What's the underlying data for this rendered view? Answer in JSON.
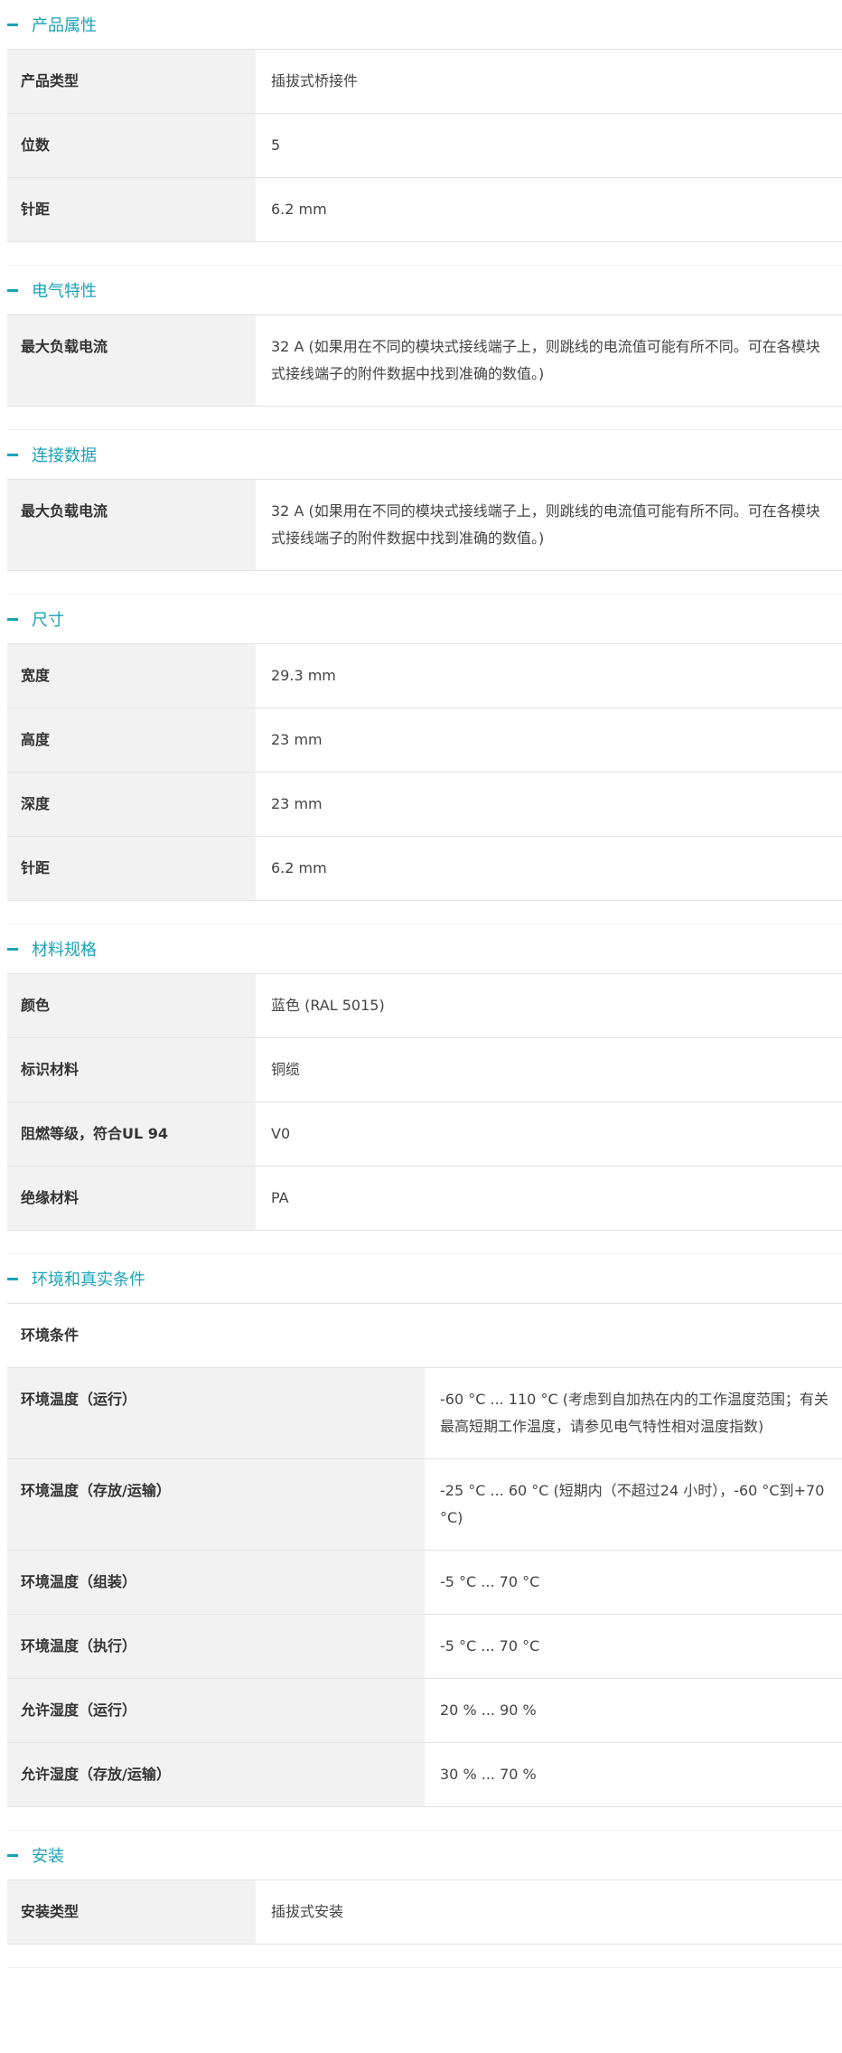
{
  "accent_color": "#1aa3b7",
  "sections": [
    {
      "title": "产品属性",
      "rows": [
        {
          "label": "产品类型",
          "value": "插拔式桥接件"
        },
        {
          "label": "位数",
          "value": "5"
        },
        {
          "label": "针距",
          "value": "6.2 mm"
        }
      ]
    },
    {
      "title": "电气特性",
      "rows": [
        {
          "label": "最大负载电流",
          "value": "32 A (如果用在不同的模块式接线端子上，则跳线的电流值可能有所不同。可在各模块式接线端子的附件数据中找到准确的数值。)"
        }
      ]
    },
    {
      "title": "连接数据",
      "rows": [
        {
          "label": "最大负载电流",
          "value": "32 A (如果用在不同的模块式接线端子上，则跳线的电流值可能有所不同。可在各模块式接线端子的附件数据中找到准确的数值。)"
        }
      ]
    },
    {
      "title": "尺寸",
      "rows": [
        {
          "label": "宽度",
          "value": "29.3 mm"
        },
        {
          "label": "高度",
          "value": "23 mm"
        },
        {
          "label": "深度",
          "value": "23 mm"
        },
        {
          "label": "针距",
          "value": "6.2 mm"
        }
      ]
    },
    {
      "title": "材料规格",
      "rows": [
        {
          "label": "颜色",
          "value": "蓝色 (RAL 5015)"
        },
        {
          "label": "标识材料",
          "value": "铜缆"
        },
        {
          "label": "阻燃等级，符合UL 94",
          "value": "V0"
        },
        {
          "label": "绝缘材料",
          "value": "PA"
        }
      ]
    },
    {
      "title": "环境和真实条件",
      "subheading": "环境条件",
      "rows": [
        {
          "label": "环境温度（运行）",
          "value": "-60 °C ... 110 °C (考虑到自加热在内的工作温度范围；有关最高短期工作温度，请参见电气特性相对温度指数)"
        },
        {
          "label": "环境温度（存放/运输）",
          "value": "-25 °C ... 60 °C (短期内（不超过24 小时），-60 °C到+70 °C)"
        },
        {
          "label": "环境温度（组装）",
          "value": "-5 °C ... 70 °C"
        },
        {
          "label": "环境温度（执行）",
          "value": "-5 °C ... 70 °C"
        },
        {
          "label": "允许湿度（运行）",
          "value": "20 % ... 90 %"
        },
        {
          "label": "允许湿度（存放/运输）",
          "value": "30 % ... 70 %"
        }
      ]
    },
    {
      "title": "安装",
      "rows": [
        {
          "label": "安装类型",
          "value": "插拔式安装"
        }
      ]
    }
  ]
}
